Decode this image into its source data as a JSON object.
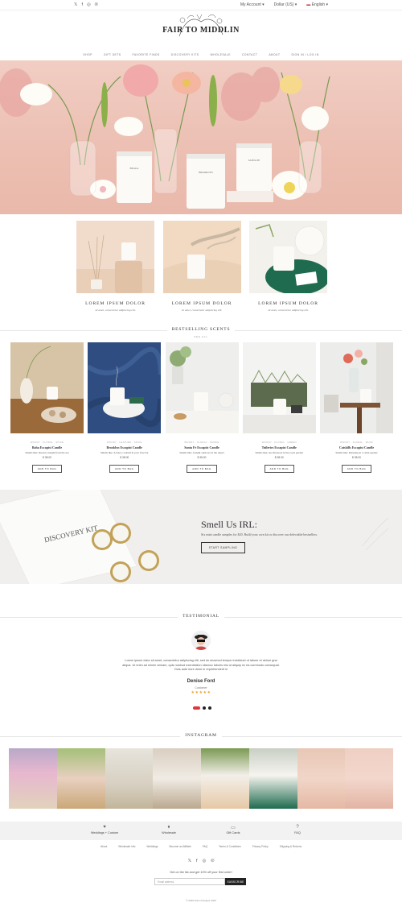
{
  "topbar": {
    "social_icons": [
      "twitter-icon",
      "facebook-icon",
      "instagram-icon",
      "pinterest-icon"
    ],
    "account": "My Account",
    "currency": "Dollar (US)",
    "language": "English"
  },
  "brand": {
    "name": "FAIR TO MIDDLIN"
  },
  "nav": [
    "SHOP",
    "GIFT SETS",
    "FAVORITE FINDS",
    "DISCOVERY KITS",
    "WHOLESALE",
    "CONTACT",
    "ABOUT",
    "SIGN IN / LOG IN"
  ],
  "features": [
    {
      "title": "LOREM IPSUM DOLOR",
      "subtitle": "sit amet, consectetur adipiscing elit."
    },
    {
      "title": "LOREM IPSUM DOLOR",
      "subtitle": "sit amet, consectetur adipiscing elit."
    },
    {
      "title": "LOREM IPSUM DOLOR",
      "subtitle": "sit amet, consectetur adipiscing elit."
    }
  ],
  "bestselling": {
    "title": "BESTSELLING SCENTS",
    "link": "SEE ALL"
  },
  "products": [
    {
      "meta": "WOODY · FLORAL · SPICE",
      "name": "Baha Escapist Candle",
      "desc": "Smells like: Resorts straight from the sea",
      "price": "$ 38.00",
      "button": "ADD TO BAG"
    },
    {
      "meta": "WOODY · LEATHER · SPICE",
      "name": "Brooklyn Escapist Candle",
      "desc": "Smells like: A fancy cocktail in your fave bar",
      "price": "$ 38.00",
      "button": "ADD TO BAG"
    },
    {
      "meta": "WOODY · FLORAL · SMOKE",
      "name": "Santa Fe Escapist Candle",
      "desc": "Smells like: A night outdoors in the desert",
      "price": "$ 38.00",
      "button": "ADD TO BAG"
    },
    {
      "meta": "WOODY · FLORAL · GREEN",
      "name": "Tuileries Escapist Candle",
      "desc": "Smells like: An afternoon in the royal garden",
      "price": "$ 38.00",
      "button": "ADD TO BAG"
    },
    {
      "meta": "WOODY · FLORAL · MUSK",
      "name": "Catskills Escapist Candle",
      "desc": "Smells like: Relaxing in a cabin upstate",
      "price": "$ 38.00",
      "button": "ADD TO BAG"
    }
  ],
  "sample": {
    "heading": "Smell Us IRL:",
    "copy": "Six mini candle samples for $20. Build your own kit or discover our delectable bestsellers.",
    "cta": "START SAMPLING",
    "kit_label": "DISCOVERY KIT"
  },
  "testimonial": {
    "title": "TESTIMONIAL",
    "quote": "Lorem ipsum dolor sit amet, consectetur adipiscing elit, sed do eiusmod tempor incididunt ut labore et dolore gna aliqua. Ut enim ad minim veniam, quis nostrud exercitation ullamco laboris nisi ut aliquip ex ea commodo consequat. Duis aute irure dolor in reprehenderit in",
    "name": "Denise Ford",
    "role": "Customer",
    "stars": "★★★★★"
  },
  "instagram": {
    "title": "INSTAGRAM"
  },
  "services": [
    {
      "icon": "heart-icon",
      "label": "Weddings + Custom"
    },
    {
      "icon": "tag-icon",
      "label": "Wholesale"
    },
    {
      "icon": "gift-icon",
      "label": "Gift Cards"
    },
    {
      "icon": "help-icon",
      "label": "FAQ"
    }
  ],
  "footer": {
    "links": [
      "About",
      "Wholesale Info",
      "Weddings",
      "Become an Affiliate",
      "FAQ",
      "Terms & Conditions",
      "Privacy Policy",
      "Shipping & Returns"
    ],
    "newsletter": "Get on the list and get 10% off your first order!",
    "email_placeholder": "Email address",
    "subscribe": "SUBSCRIBE",
    "copyright": "© 2020 Artem Designs 2020"
  },
  "colors": {
    "accent": "#e0353c",
    "hero_bg": "#efc6ba",
    "banner_bg": "#f1eeee",
    "star": "#f0a030"
  }
}
